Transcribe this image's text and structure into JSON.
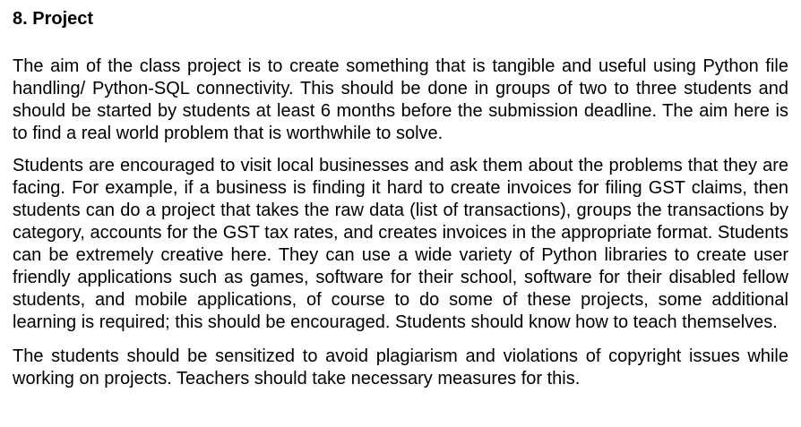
{
  "section": {
    "heading": "8. Project",
    "paragraphs": [
      "The aim of the class project is to create something that is tangible and useful using Python file handling/ Python-SQL connectivity. This should be done in groups of two to three students and should be started by students at least 6 months before the submission deadline. The aim here is to find a real world problem that is worthwhile to solve.",
      "Students are encouraged to visit local businesses and ask them about the problems that they are facing. For example, if a business is finding it hard to create invoices for filing GST claims, then students can do a project that takes the raw data (list of transactions), groups the transactions by category, accounts for the GST tax rates, and creates invoices in the appropriate format. Students can be extremely creative here. They can use a wide variety of Python libraries to create user friendly applications such as games, software for their school, software for their disabled fellow students, and mobile applications, of course to do some of these projects, some additional learning is required; this should be encouraged. Students should know how to teach themselves.",
      "The students should be sensitized to avoid plagiarism and violations of copyright issues while working on projects. Teachers should take necessary measures for this."
    ]
  }
}
